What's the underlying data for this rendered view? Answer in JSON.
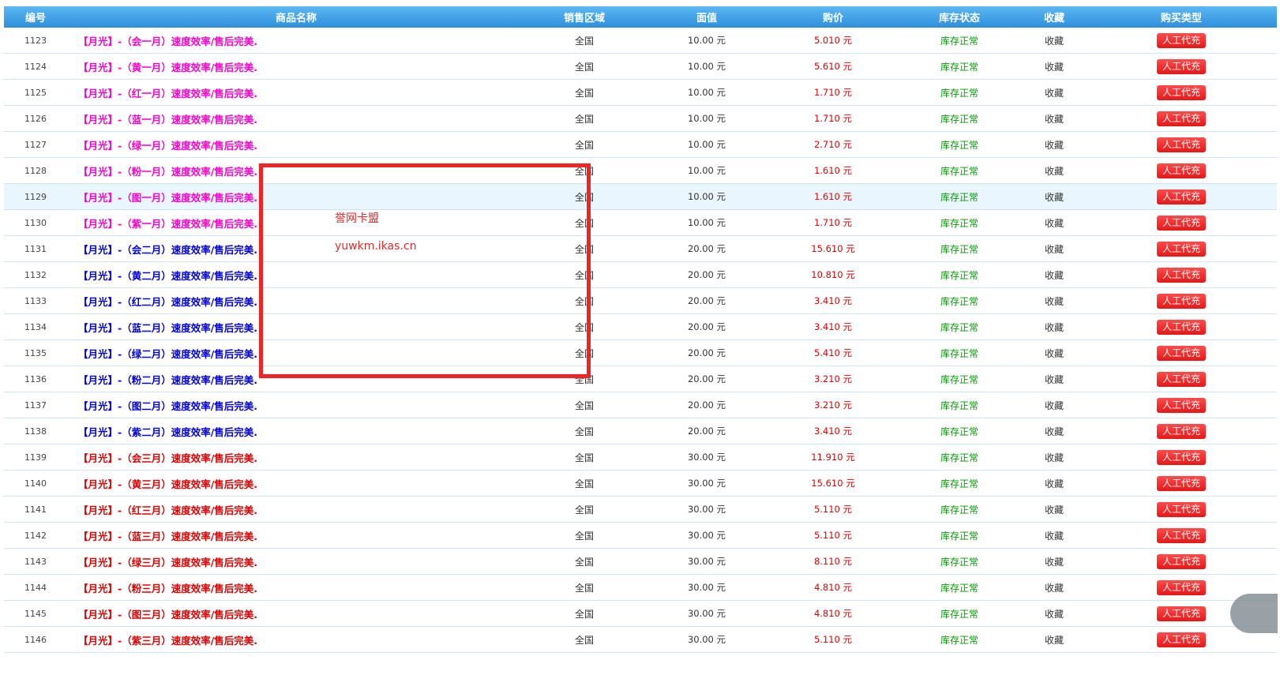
{
  "columns": [
    "编号",
    "商品名称",
    "销售区域",
    "面值",
    "购价",
    "库存状态",
    "收藏",
    "购买类型"
  ],
  "colors": {
    "header": "#3c9fe8",
    "name_tier1": "#ff00cc",
    "name_tier2": "#0000e0",
    "name_tier3": "#e00000",
    "price": "#e00000",
    "stock": "#009b00",
    "button": "#ee2222",
    "annotation": "#ef2525"
  },
  "rows": [
    {
      "id": "1123",
      "name": "【月光】-（会一月）速度效率/售后完美.",
      "tier": 1,
      "region": "全国",
      "face": "10.00 元",
      "price": "5.010 元",
      "stock": "库存正常",
      "fav": "收藏",
      "buy": "人工代充"
    },
    {
      "id": "1124",
      "name": "【月光】-（黄一月）速度效率/售后完美.",
      "tier": 1,
      "region": "全国",
      "face": "10.00 元",
      "price": "5.610 元",
      "stock": "库存正常",
      "fav": "收藏",
      "buy": "人工代充"
    },
    {
      "id": "1125",
      "name": "【月光】-（红一月）速度效率/售后完美.",
      "tier": 1,
      "region": "全国",
      "face": "10.00 元",
      "price": "1.710 元",
      "stock": "库存正常",
      "fav": "收藏",
      "buy": "人工代充"
    },
    {
      "id": "1126",
      "name": "【月光】-（蓝一月）速度效率/售后完美.",
      "tier": 1,
      "region": "全国",
      "face": "10.00 元",
      "price": "1.710 元",
      "stock": "库存正常",
      "fav": "收藏",
      "buy": "人工代充"
    },
    {
      "id": "1127",
      "name": "【月光】-（绿一月）速度效率/售后完美.",
      "tier": 1,
      "region": "全国",
      "face": "10.00 元",
      "price": "2.710 元",
      "stock": "库存正常",
      "fav": "收藏",
      "buy": "人工代充"
    },
    {
      "id": "1128",
      "name": "【月光】-（粉一月）速度效率/售后完美.",
      "tier": 1,
      "region": "全国",
      "face": "10.00 元",
      "price": "1.610 元",
      "stock": "库存正常",
      "fav": "收藏",
      "buy": "人工代充"
    },
    {
      "id": "1129",
      "name": "【月光】-（图一月）速度效率/售后完美.",
      "tier": 1,
      "region": "全国",
      "face": "10.00 元",
      "price": "1.610 元",
      "stock": "库存正常",
      "fav": "收藏",
      "buy": "人工代充",
      "highlight": true
    },
    {
      "id": "1130",
      "name": "【月光】-（紫一月）速度效率/售后完美.",
      "tier": 1,
      "region": "全国",
      "face": "10.00 元",
      "price": "1.710 元",
      "stock": "库存正常",
      "fav": "收藏",
      "buy": "人工代充"
    },
    {
      "id": "1131",
      "name": "【月光】-（会二月）速度效率/售后完美.",
      "tier": 2,
      "region": "全国",
      "face": "20.00 元",
      "price": "15.610 元",
      "stock": "库存正常",
      "fav": "收藏",
      "buy": "人工代充"
    },
    {
      "id": "1132",
      "name": "【月光】-（黄二月）速度效率/售后完美.",
      "tier": 2,
      "region": "全国",
      "face": "20.00 元",
      "price": "10.810 元",
      "stock": "库存正常",
      "fav": "收藏",
      "buy": "人工代充"
    },
    {
      "id": "1133",
      "name": "【月光】-（红二月）速度效率/售后完美.",
      "tier": 2,
      "region": "全国",
      "face": "20.00 元",
      "price": "3.410 元",
      "stock": "库存正常",
      "fav": "收藏",
      "buy": "人工代充"
    },
    {
      "id": "1134",
      "name": "【月光】-（蓝二月）速度效率/售后完美.",
      "tier": 2,
      "region": "全国",
      "face": "20.00 元",
      "price": "3.410 元",
      "stock": "库存正常",
      "fav": "收藏",
      "buy": "人工代充"
    },
    {
      "id": "1135",
      "name": "【月光】-（绿二月）速度效率/售后完美.",
      "tier": 2,
      "region": "全国",
      "face": "20.00 元",
      "price": "5.410 元",
      "stock": "库存正常",
      "fav": "收藏",
      "buy": "人工代充"
    },
    {
      "id": "1136",
      "name": "【月光】-（粉二月）速度效率/售后完美.",
      "tier": 2,
      "region": "全国",
      "face": "20.00 元",
      "price": "3.210 元",
      "stock": "库存正常",
      "fav": "收藏",
      "buy": "人工代充"
    },
    {
      "id": "1137",
      "name": "【月光】-（图二月）速度效率/售后完美.",
      "tier": 2,
      "region": "全国",
      "face": "20.00 元",
      "price": "3.210 元",
      "stock": "库存正常",
      "fav": "收藏",
      "buy": "人工代充"
    },
    {
      "id": "1138",
      "name": "【月光】-（紫二月）速度效率/售后完美.",
      "tier": 2,
      "region": "全国",
      "face": "20.00 元",
      "price": "3.410 元",
      "stock": "库存正常",
      "fav": "收藏",
      "buy": "人工代充"
    },
    {
      "id": "1139",
      "name": "【月光】-（会三月）速度效率/售后完美.",
      "tier": 3,
      "region": "全国",
      "face": "30.00 元",
      "price": "11.910 元",
      "stock": "库存正常",
      "fav": "收藏",
      "buy": "人工代充"
    },
    {
      "id": "1140",
      "name": "【月光】-（黄三月）速度效率/售后完美.",
      "tier": 3,
      "region": "全国",
      "face": "30.00 元",
      "price": "15.610 元",
      "stock": "库存正常",
      "fav": "收藏",
      "buy": "人工代充"
    },
    {
      "id": "1141",
      "name": "【月光】-（红三月）速度效率/售后完美.",
      "tier": 3,
      "region": "全国",
      "face": "30.00 元",
      "price": "5.110 元",
      "stock": "库存正常",
      "fav": "收藏",
      "buy": "人工代充"
    },
    {
      "id": "1142",
      "name": "【月光】-（蓝三月）速度效率/售后完美.",
      "tier": 3,
      "region": "全国",
      "face": "30.00 元",
      "price": "5.110 元",
      "stock": "库存正常",
      "fav": "收藏",
      "buy": "人工代充"
    },
    {
      "id": "1143",
      "name": "【月光】-（绿三月）速度效率/售后完美.",
      "tier": 3,
      "region": "全国",
      "face": "30.00 元",
      "price": "8.110 元",
      "stock": "库存正常",
      "fav": "收藏",
      "buy": "人工代充"
    },
    {
      "id": "1144",
      "name": "【月光】-（粉三月）速度效率/售后完美.",
      "tier": 3,
      "region": "全国",
      "face": "30.00 元",
      "price": "4.810 元",
      "stock": "库存正常",
      "fav": "收藏",
      "buy": "人工代充"
    },
    {
      "id": "1145",
      "name": "【月光】-（图三月）速度效率/售后完美.",
      "tier": 3,
      "region": "全国",
      "face": "30.00 元",
      "price": "4.810 元",
      "stock": "库存正常",
      "fav": "收藏",
      "buy": "人工代充"
    },
    {
      "id": "1146",
      "name": "【月光】-（紫三月）速度效率/售后完美.",
      "tier": 3,
      "region": "全国",
      "face": "30.00 元",
      "price": "5.110 元",
      "stock": "库存正常",
      "fav": "收藏",
      "buy": "人工代充"
    }
  ],
  "watermark": {
    "line1": "誉网卡盟",
    "line2": "yuwkm.ikas.cn"
  }
}
